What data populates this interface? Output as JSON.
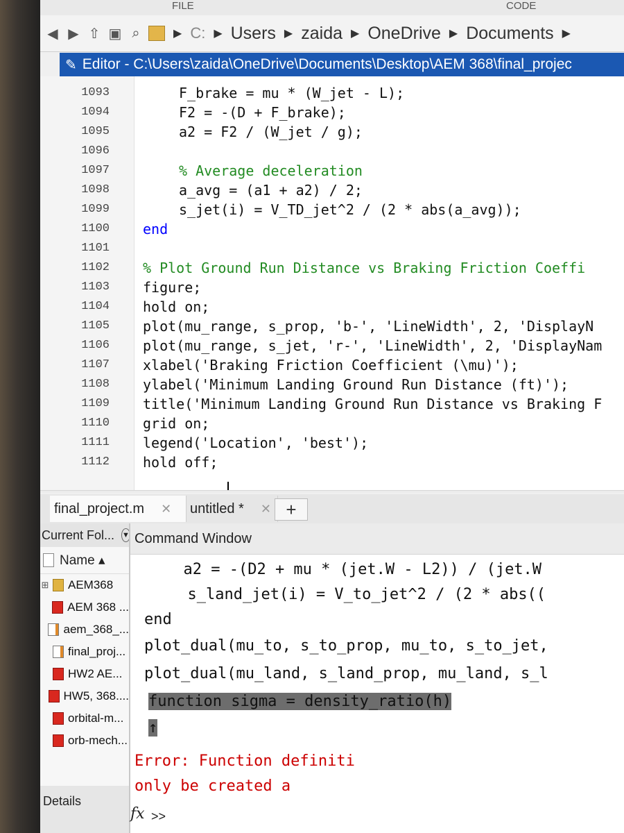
{
  "ribbon": {
    "labels": [
      "FILE",
      "CODE"
    ]
  },
  "address_bar": {
    "crumbs": [
      "C:",
      "Users",
      "zaida",
      "OneDrive",
      "Documents"
    ]
  },
  "editor": {
    "title": "Editor - C:\\Users\\zaida\\OneDrive\\Documents\\Desktop\\AEM 368\\final_projec",
    "lines": [
      {
        "num": "1093",
        "text": "F_brake = mu * (W_jet - L);",
        "kind": "code"
      },
      {
        "num": "1094",
        "text": "F2 = -(D + F_brake);",
        "kind": "code"
      },
      {
        "num": "1095",
        "text": "a2 = F2 / (W_jet / g);",
        "kind": "code"
      },
      {
        "num": "1096",
        "text": "",
        "kind": "code"
      },
      {
        "num": "1097",
        "text": "% Average deceleration",
        "kind": "comment"
      },
      {
        "num": "1098",
        "text": "a_avg = (a1 + a2) / 2;",
        "kind": "code"
      },
      {
        "num": "1099",
        "text": "s_jet(i) = V_TD_jet^2 / (2 * abs(a_avg));",
        "kind": "code"
      },
      {
        "num": "1100",
        "text": "end",
        "kind": "keyword"
      },
      {
        "num": "1101",
        "text": "",
        "kind": "code"
      },
      {
        "num": "1102",
        "text": "% Plot Ground Run Distance vs Braking Friction Coeffi",
        "kind": "comment"
      },
      {
        "num": "1103",
        "text": "figure;",
        "kind": "code"
      },
      {
        "num": "1104",
        "text": "hold on;",
        "kind": "code"
      },
      {
        "num": "1105",
        "text": "plot(mu_range, s_prop, 'b-', 'LineWidth', 2, 'DisplayN",
        "kind": "code"
      },
      {
        "num": "1106",
        "text": "plot(mu_range, s_jet, 'r-', 'LineWidth', 2, 'DisplayNam",
        "kind": "code"
      },
      {
        "num": "1107",
        "text": "xlabel('Braking Friction Coefficient (\\mu)');",
        "kind": "code"
      },
      {
        "num": "1108",
        "text": "ylabel('Minimum Landing Ground Run Distance (ft)');",
        "kind": "code"
      },
      {
        "num": "1109",
        "text": "title('Minimum Landing Ground Run Distance vs Braking F",
        "kind": "code"
      },
      {
        "num": "1110",
        "text": "grid on;",
        "kind": "code"
      },
      {
        "num": "1111",
        "text": "legend('Location', 'best');",
        "kind": "code"
      },
      {
        "num": "1112",
        "text": "hold off;",
        "kind": "code"
      }
    ]
  },
  "tabs": [
    {
      "label": "final_project.m",
      "close": "✕"
    },
    {
      "label": "untitled *",
      "close": "✕"
    }
  ],
  "tab_add": "+",
  "current_folder": {
    "title": "Current Fol...",
    "column": "Name ▴",
    "files": [
      {
        "name": "AEM368",
        "type": "folder",
        "expander": "⊞"
      },
      {
        "name": "AEM 368 ...",
        "type": "pdf",
        "expander": ""
      },
      {
        "name": "aem_368_...",
        "type": "mfile",
        "expander": ""
      },
      {
        "name": "final_proj...",
        "type": "mfile",
        "expander": ""
      },
      {
        "name": "HW2 AE...",
        "type": "pdf",
        "expander": ""
      },
      {
        "name": "HW5, 368....",
        "type": "pdf",
        "expander": ""
      },
      {
        "name": "orbital-m...",
        "type": "pdf",
        "expander": ""
      },
      {
        "name": "orb-mech...",
        "type": "pdf",
        "expander": ""
      }
    ],
    "details_label": "Details"
  },
  "command_window": {
    "title": "Command Window",
    "lines": [
      {
        "text": "  a2 = -(D2 + mu * (jet.W - L2)) / (jet.W",
        "kind": "code"
      },
      {
        "text": "  s_land_jet(i) = V_to_jet^2 / (2 * abs((",
        "kind": "code"
      },
      {
        "text": "end",
        "kind": "keyword"
      },
      {
        "text": "plot_dual(mu_to, s_to_prop, mu_to, s_to_jet,",
        "kind": "code"
      },
      {
        "text": "plot_dual(mu_land, s_land_prop, mu_land, s_l",
        "kind": "code"
      },
      {
        "text": "function sigma = density_ratio(h)",
        "kind": "highlight"
      },
      {
        "text": "↑",
        "kind": "highlight"
      },
      {
        "text": "Error: Function definiti",
        "kind": "error"
      },
      {
        "text": "only be created a",
        "kind": "error"
      }
    ],
    "fx_symbol": "fx",
    "prompt": ">>"
  }
}
